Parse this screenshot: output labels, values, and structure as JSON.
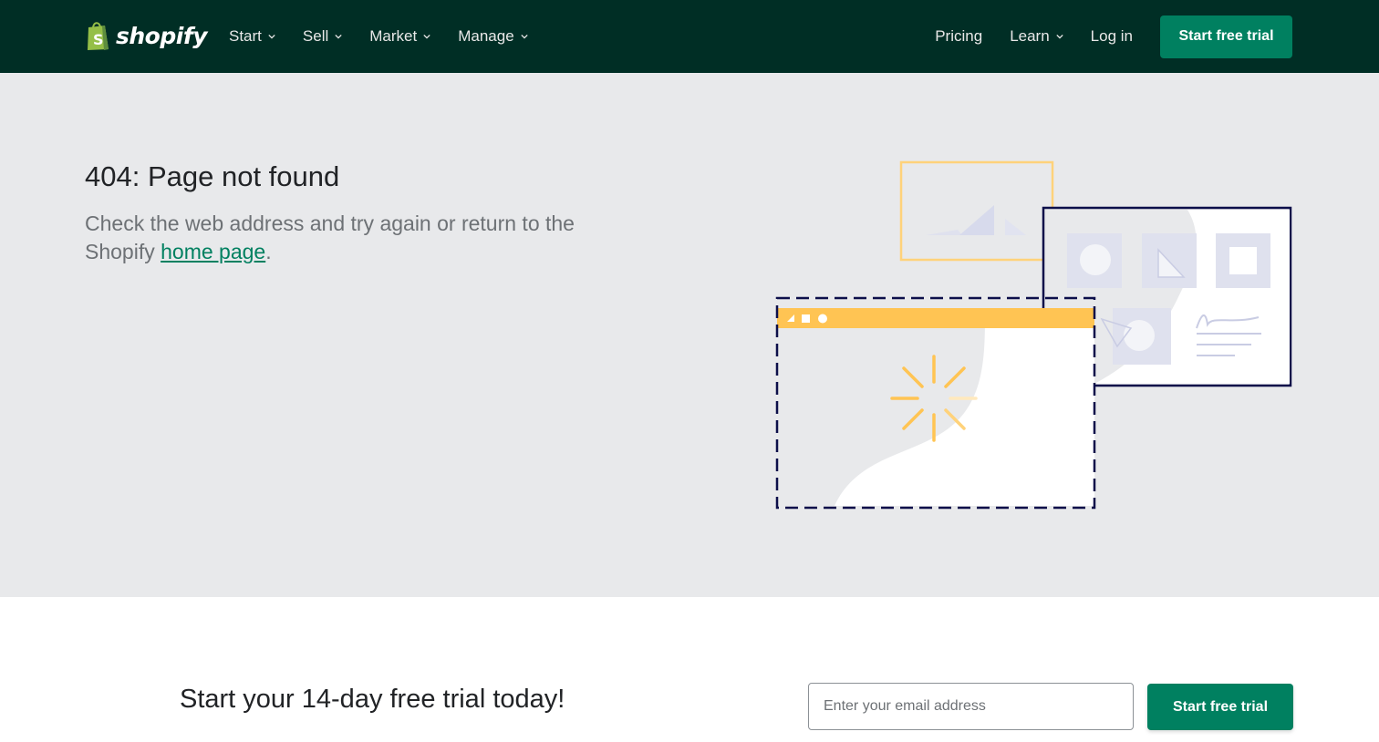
{
  "header": {
    "brand": "shopify",
    "nav_left": [
      {
        "label": "Start"
      },
      {
        "label": "Sell"
      },
      {
        "label": "Market"
      },
      {
        "label": "Manage"
      }
    ],
    "nav_right": {
      "pricing": "Pricing",
      "learn": "Learn",
      "login": "Log in",
      "cta": "Start free trial"
    }
  },
  "hero": {
    "title": "404: Page not found",
    "message_before": "Check the web address and try again or return to the Shopify ",
    "link_text": "home page",
    "message_after": "."
  },
  "cta": {
    "heading": "Start your 14-day free trial today!",
    "email_placeholder": "Enter your email address",
    "button": "Start free trial"
  },
  "colors": {
    "header_bg": "#002e25",
    "accent": "#008060",
    "hero_bg": "#e8e9eb",
    "illustration_yellow": "#ffc453",
    "illustration_navy": "#0c0f4a"
  }
}
